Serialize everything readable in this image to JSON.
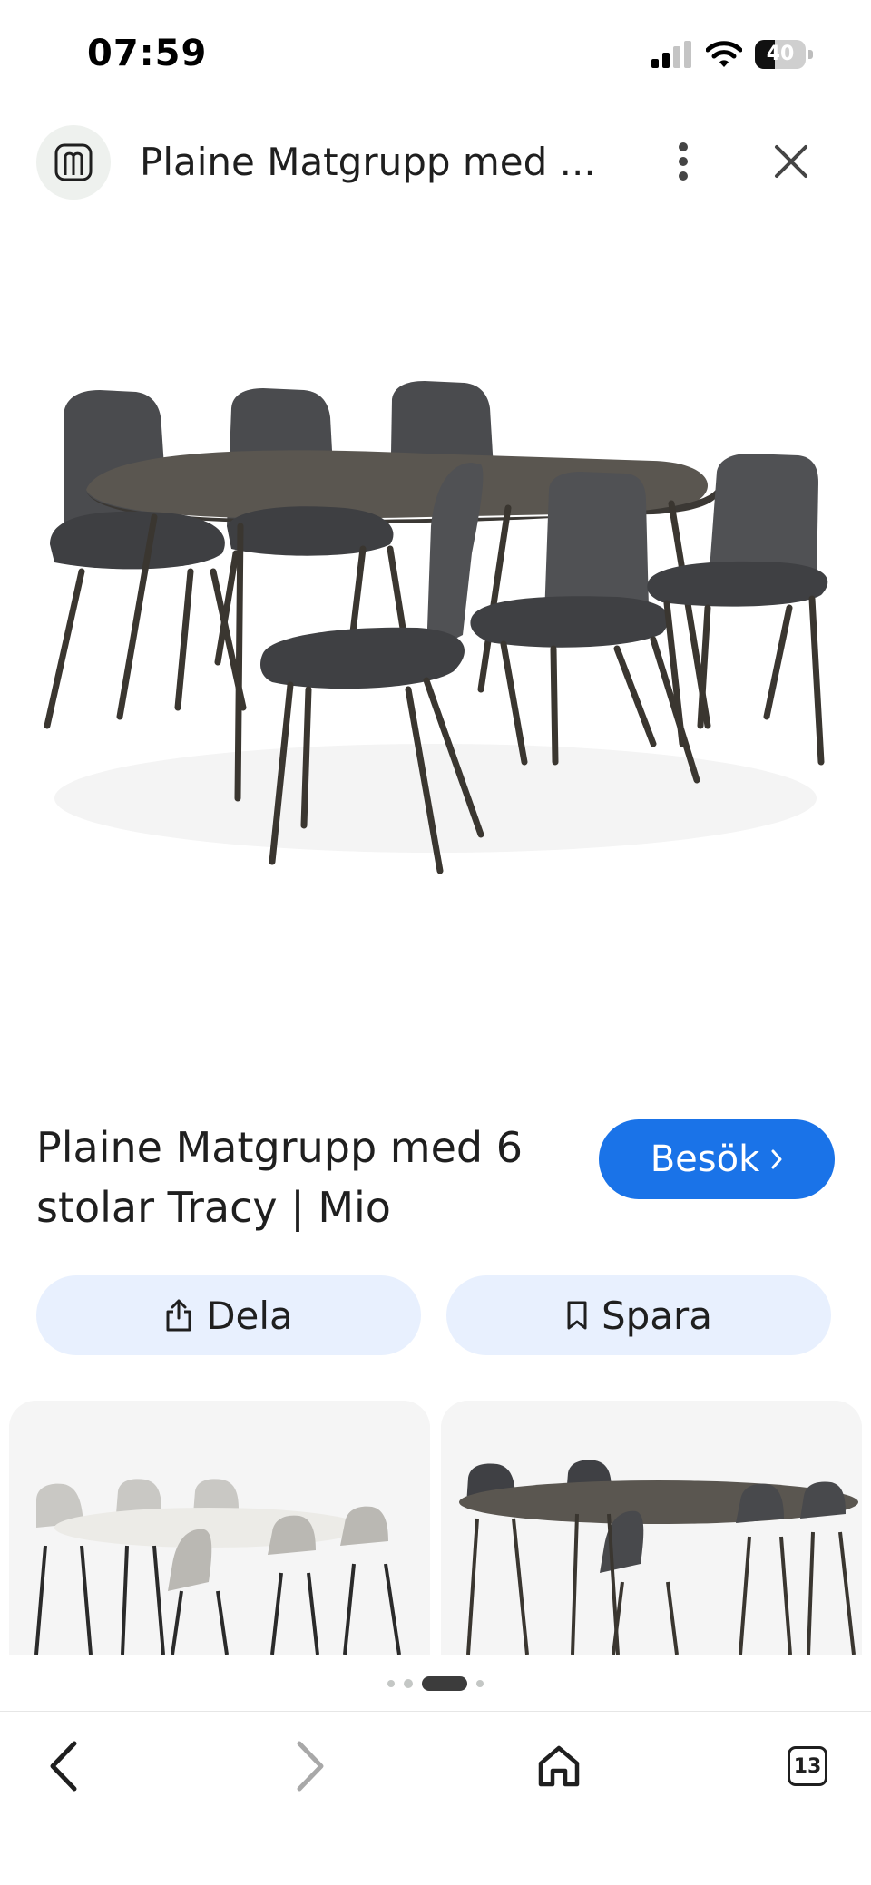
{
  "status_bar": {
    "time": "07:59",
    "battery_level": "40",
    "battery_fraction": 0.4
  },
  "header": {
    "title": "Plaine Matgrupp med ...",
    "logo_icon": "site-logo-icon",
    "more_icon": "more-vertical-icon",
    "close_icon": "close-icon"
  },
  "product": {
    "title": "Plaine Matgrupp med 6 stolar Tracy | Mio",
    "visit_label": "Besök",
    "visit_color": "#1a73e8"
  },
  "actions": {
    "share_label": "Dela",
    "save_label": "Spara",
    "button_bg": "#e8f0fe"
  },
  "navigation": {
    "tab_count": "13",
    "back_icon": "chevron-left-icon",
    "forward_icon": "chevron-right-icon",
    "home_icon": "home-icon",
    "tabs_icon": "tabs-icon"
  }
}
